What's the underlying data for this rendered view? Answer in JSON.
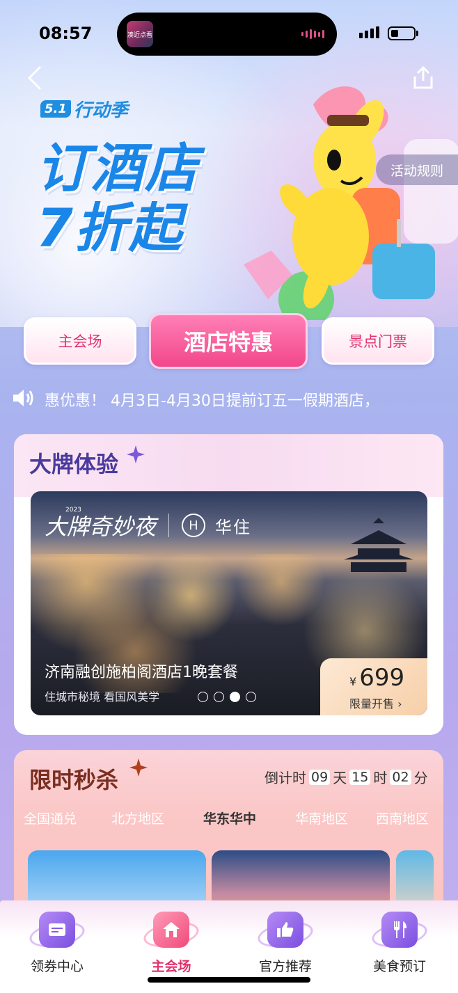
{
  "status_bar": {
    "time": "08:57",
    "island_thumb_text": "凑近点看"
  },
  "hero": {
    "campaign_badge": "5.1",
    "campaign_name": "行动季",
    "headline_line1": "订酒店",
    "headline_line2": "7折起",
    "rules_button": "活动规则",
    "back_icon": "chevron-left-icon",
    "share_icon": "share-icon"
  },
  "tabs": [
    {
      "label": "主会场"
    },
    {
      "label": "酒店特惠"
    },
    {
      "label": "景点门票"
    }
  ],
  "notice": {
    "icon": "speaker-icon",
    "text": "惠优惠！  4月3日-4月30日提前订五一假期酒店，"
  },
  "brand_section": {
    "title": "大牌体验",
    "banner": {
      "event_script": "大牌奇妙夜",
      "event_year": "2023",
      "brand_logo": "H",
      "brand_name": "华住",
      "title": "济南融创施柏阁酒店1晚套餐",
      "subtitle": "住城市秘境 看国风美学",
      "price_symbol": "¥",
      "price": "699",
      "price_label": "限量开售",
      "carousel_index": 3,
      "carousel_total": 4
    }
  },
  "flash_sale": {
    "title": "限时秒杀",
    "countdown_label": "倒计时",
    "days": "09",
    "days_unit": "天",
    "hours": "15",
    "hours_unit": "时",
    "minutes": "02",
    "minutes_unit": "分",
    "regions": [
      {
        "label": "全国通兑"
      },
      {
        "label": "北方地区"
      },
      {
        "label": "华东华中"
      },
      {
        "label": "华南地区"
      },
      {
        "label": "西南地区"
      }
    ],
    "active_region": "华东华中"
  },
  "tabbar": [
    {
      "label": "领券中心",
      "icon": "coupon-icon"
    },
    {
      "label": "主会场",
      "icon": "home-icon"
    },
    {
      "label": "官方推荐",
      "icon": "thumbs-up-icon"
    },
    {
      "label": "美食预订",
      "icon": "fork-knife-icon"
    }
  ],
  "colors": {
    "accent_pink": "#e0316b",
    "headline_blue": "#1a86e8",
    "section_title_purple": "#4a3a9c",
    "flash_title_brown": "#7a2e20"
  }
}
